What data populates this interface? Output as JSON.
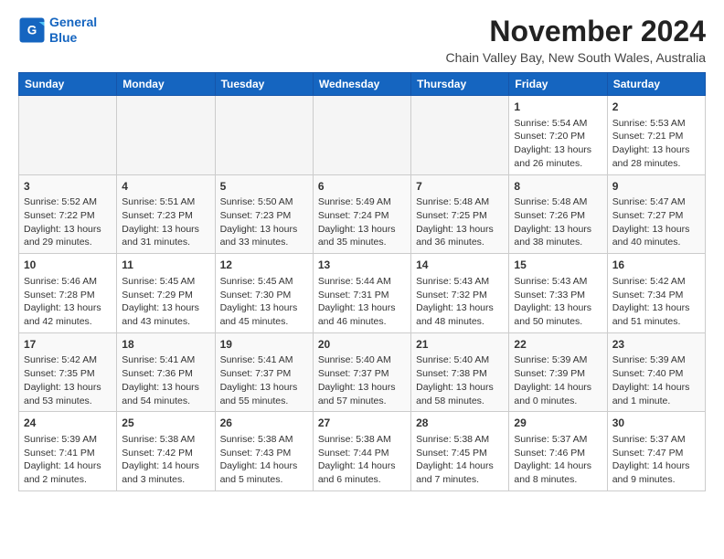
{
  "header": {
    "logo_line1": "General",
    "logo_line2": "Blue",
    "month": "November 2024",
    "location": "Chain Valley Bay, New South Wales, Australia"
  },
  "weekdays": [
    "Sunday",
    "Monday",
    "Tuesday",
    "Wednesday",
    "Thursday",
    "Friday",
    "Saturday"
  ],
  "weeks": [
    [
      {
        "day": "",
        "info": ""
      },
      {
        "day": "",
        "info": ""
      },
      {
        "day": "",
        "info": ""
      },
      {
        "day": "",
        "info": ""
      },
      {
        "day": "",
        "info": ""
      },
      {
        "day": "1",
        "info": "Sunrise: 5:54 AM\nSunset: 7:20 PM\nDaylight: 13 hours\nand 26 minutes."
      },
      {
        "day": "2",
        "info": "Sunrise: 5:53 AM\nSunset: 7:21 PM\nDaylight: 13 hours\nand 28 minutes."
      }
    ],
    [
      {
        "day": "3",
        "info": "Sunrise: 5:52 AM\nSunset: 7:22 PM\nDaylight: 13 hours\nand 29 minutes."
      },
      {
        "day": "4",
        "info": "Sunrise: 5:51 AM\nSunset: 7:23 PM\nDaylight: 13 hours\nand 31 minutes."
      },
      {
        "day": "5",
        "info": "Sunrise: 5:50 AM\nSunset: 7:23 PM\nDaylight: 13 hours\nand 33 minutes."
      },
      {
        "day": "6",
        "info": "Sunrise: 5:49 AM\nSunset: 7:24 PM\nDaylight: 13 hours\nand 35 minutes."
      },
      {
        "day": "7",
        "info": "Sunrise: 5:48 AM\nSunset: 7:25 PM\nDaylight: 13 hours\nand 36 minutes."
      },
      {
        "day": "8",
        "info": "Sunrise: 5:48 AM\nSunset: 7:26 PM\nDaylight: 13 hours\nand 38 minutes."
      },
      {
        "day": "9",
        "info": "Sunrise: 5:47 AM\nSunset: 7:27 PM\nDaylight: 13 hours\nand 40 minutes."
      }
    ],
    [
      {
        "day": "10",
        "info": "Sunrise: 5:46 AM\nSunset: 7:28 PM\nDaylight: 13 hours\nand 42 minutes."
      },
      {
        "day": "11",
        "info": "Sunrise: 5:45 AM\nSunset: 7:29 PM\nDaylight: 13 hours\nand 43 minutes."
      },
      {
        "day": "12",
        "info": "Sunrise: 5:45 AM\nSunset: 7:30 PM\nDaylight: 13 hours\nand 45 minutes."
      },
      {
        "day": "13",
        "info": "Sunrise: 5:44 AM\nSunset: 7:31 PM\nDaylight: 13 hours\nand 46 minutes."
      },
      {
        "day": "14",
        "info": "Sunrise: 5:43 AM\nSunset: 7:32 PM\nDaylight: 13 hours\nand 48 minutes."
      },
      {
        "day": "15",
        "info": "Sunrise: 5:43 AM\nSunset: 7:33 PM\nDaylight: 13 hours\nand 50 minutes."
      },
      {
        "day": "16",
        "info": "Sunrise: 5:42 AM\nSunset: 7:34 PM\nDaylight: 13 hours\nand 51 minutes."
      }
    ],
    [
      {
        "day": "17",
        "info": "Sunrise: 5:42 AM\nSunset: 7:35 PM\nDaylight: 13 hours\nand 53 minutes."
      },
      {
        "day": "18",
        "info": "Sunrise: 5:41 AM\nSunset: 7:36 PM\nDaylight: 13 hours\nand 54 minutes."
      },
      {
        "day": "19",
        "info": "Sunrise: 5:41 AM\nSunset: 7:37 PM\nDaylight: 13 hours\nand 55 minutes."
      },
      {
        "day": "20",
        "info": "Sunrise: 5:40 AM\nSunset: 7:37 PM\nDaylight: 13 hours\nand 57 minutes."
      },
      {
        "day": "21",
        "info": "Sunrise: 5:40 AM\nSunset: 7:38 PM\nDaylight: 13 hours\nand 58 minutes."
      },
      {
        "day": "22",
        "info": "Sunrise: 5:39 AM\nSunset: 7:39 PM\nDaylight: 14 hours\nand 0 minutes."
      },
      {
        "day": "23",
        "info": "Sunrise: 5:39 AM\nSunset: 7:40 PM\nDaylight: 14 hours\nand 1 minute."
      }
    ],
    [
      {
        "day": "24",
        "info": "Sunrise: 5:39 AM\nSunset: 7:41 PM\nDaylight: 14 hours\nand 2 minutes."
      },
      {
        "day": "25",
        "info": "Sunrise: 5:38 AM\nSunset: 7:42 PM\nDaylight: 14 hours\nand 3 minutes."
      },
      {
        "day": "26",
        "info": "Sunrise: 5:38 AM\nSunset: 7:43 PM\nDaylight: 14 hours\nand 5 minutes."
      },
      {
        "day": "27",
        "info": "Sunrise: 5:38 AM\nSunset: 7:44 PM\nDaylight: 14 hours\nand 6 minutes."
      },
      {
        "day": "28",
        "info": "Sunrise: 5:38 AM\nSunset: 7:45 PM\nDaylight: 14 hours\nand 7 minutes."
      },
      {
        "day": "29",
        "info": "Sunrise: 5:37 AM\nSunset: 7:46 PM\nDaylight: 14 hours\nand 8 minutes."
      },
      {
        "day": "30",
        "info": "Sunrise: 5:37 AM\nSunset: 7:47 PM\nDaylight: 14 hours\nand 9 minutes."
      }
    ]
  ]
}
